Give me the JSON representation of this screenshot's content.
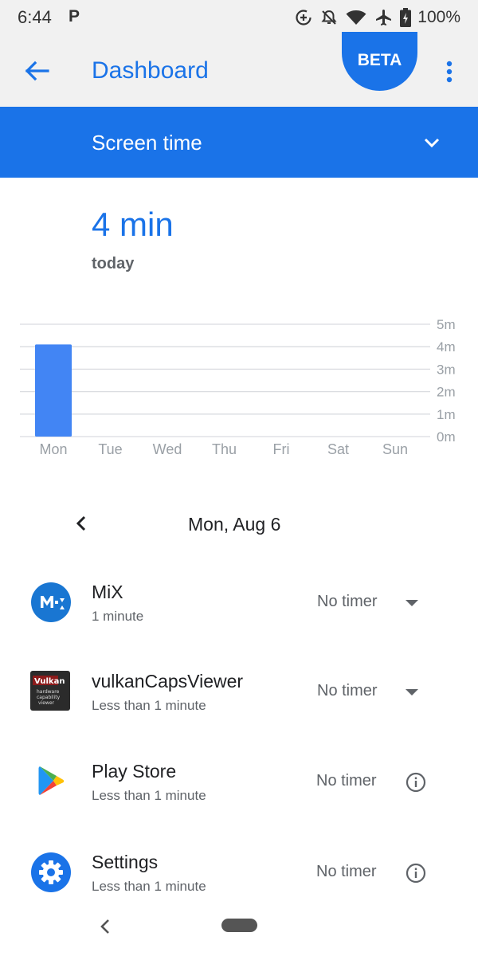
{
  "status_bar": {
    "time": "6:44",
    "notification_letter": "P",
    "battery": "100%",
    "icons": [
      "data-saver-icon",
      "alarm-off-icon",
      "wifi-icon",
      "airplane-icon",
      "battery-charging-icon"
    ]
  },
  "app_bar": {
    "title": "Dashboard",
    "badge": "BETA",
    "back_icon": "arrow-back-icon",
    "more_icon": "more-vert-icon",
    "accent_color": "#1a73e8"
  },
  "section": {
    "title": "Screen time",
    "dropdown_icon": "chevron-down-icon"
  },
  "summary": {
    "total": "4 min",
    "period": "today"
  },
  "chart_data": {
    "type": "bar",
    "categories": [
      "Mon",
      "Tue",
      "Wed",
      "Thu",
      "Fri",
      "Sat",
      "Sun"
    ],
    "values": [
      4.1,
      0,
      0,
      0,
      0,
      0,
      0
    ],
    "y_ticks": [
      "0m",
      "1m",
      "2m",
      "3m",
      "4m",
      "5m"
    ],
    "ylim": [
      0,
      5
    ],
    "grid": true,
    "bar_color": "#4285f4",
    "title": "",
    "xlabel": "",
    "ylabel": ""
  },
  "date_nav": {
    "label": "Mon, Aug 6",
    "prev_icon": "chevron-left-icon"
  },
  "apps": [
    {
      "name": "MiX",
      "usage": "1 minute",
      "timer": "No timer",
      "control_icon": "dropdown-arrow-icon",
      "icon": "mix-app-icon"
    },
    {
      "name": "vulkanCapsViewer",
      "usage": "Less than 1 minute",
      "timer": "No timer",
      "control_icon": "dropdown-arrow-icon",
      "icon": "vulkan-caps-viewer-app-icon",
      "icon_text": "Vulkan hardware capability viewer"
    },
    {
      "name": "Play Store",
      "usage": "Less than 1 minute",
      "timer": "No timer",
      "control_icon": "info-icon",
      "icon": "play-store-app-icon"
    },
    {
      "name": "Settings",
      "usage": "Less than 1 minute",
      "timer": "No timer",
      "control_icon": "info-icon",
      "icon": "settings-gear-app-icon"
    }
  ],
  "nav_bar": {
    "back_icon": "nav-back-icon",
    "home_icon": "home-pill-icon"
  }
}
